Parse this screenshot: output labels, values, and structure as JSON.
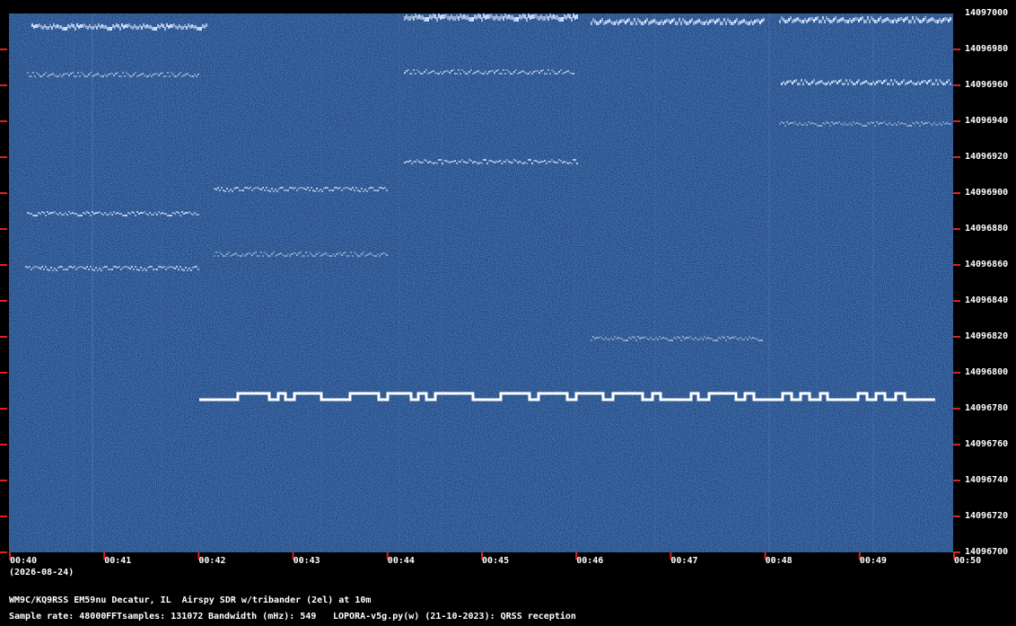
{
  "colors": {
    "background": "#000000",
    "waterfall_base": "#1a3f7e",
    "tick": "#e02020",
    "trace": "#ffffff"
  },
  "y_axis": {
    "labels": [
      "14097000",
      "14096980",
      "14096960",
      "14096940",
      "14096920",
      "14096900",
      "14096880",
      "14096860",
      "14096840",
      "14096820",
      "14096800",
      "14096780",
      "14096760",
      "14096740",
      "14096720",
      "14096700"
    ]
  },
  "x_axis": {
    "labels": [
      "00:40",
      "00:41",
      "00:42",
      "00:43",
      "00:44",
      "00:45",
      "00:46",
      "00:47",
      "00:48",
      "00:49",
      "00:50"
    ],
    "date": "(2026-08-24)"
  },
  "footer": {
    "station": "WM9C/KQ9RSS EM59nu Decatur, IL  Airspy SDR w/tribander (2el) at 10m",
    "sample_rate": "Sample rate: 48000",
    "fft_samples": "FFTsamples: 131072",
    "bandwidth": "Bandwidth (mHz): 549",
    "software": "LOPORA-v5g.py(w) (21-10-2023): QRSS reception"
  }
}
